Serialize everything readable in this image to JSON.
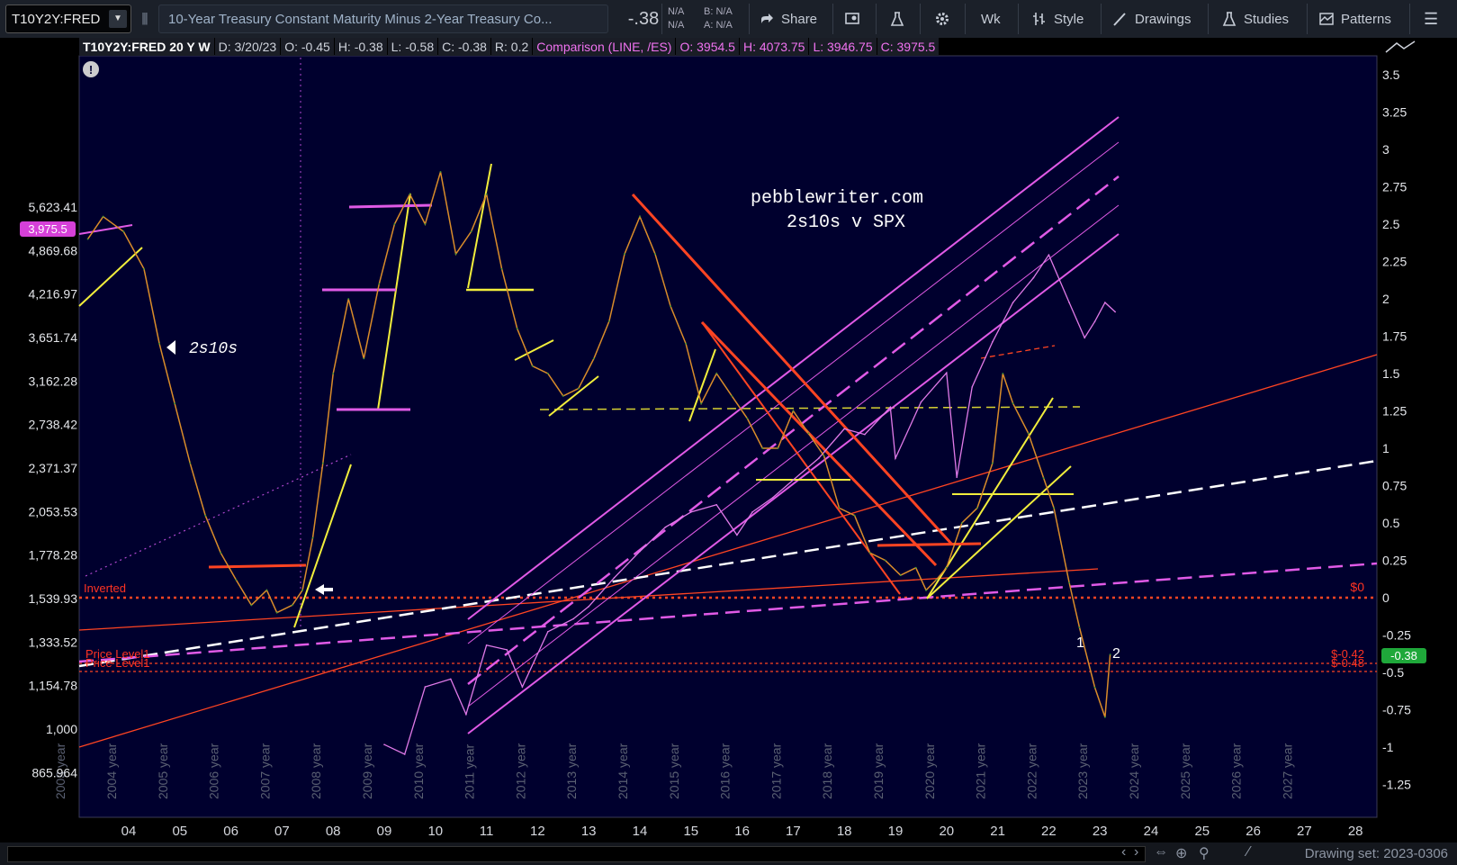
{
  "toolbar": {
    "symbol": "T10Y2Y:FRED",
    "description": "10-Year Treasury Constant Maturity Minus 2-Year Treasury Co...",
    "last": "-.38",
    "bid_na": "N/A",
    "ask_na": "N/A",
    "bid": "B: N/A",
    "ask": "A: N/A",
    "share": "Share",
    "wk": "Wk",
    "style": "Style",
    "drawings": "Drawings",
    "studies": "Studies",
    "patterns": "Patterns"
  },
  "legend": {
    "title": "T10Y2Y:FRED 20 Y W",
    "date": "D: 3/20/23",
    "open": "O: -0.45",
    "high": "H: -0.38",
    "low": "L: -0.58",
    "close": "C: -0.38",
    "range": "R: 0.2",
    "comparison": "Comparison (LINE, /ES)",
    "cmp_open": "O: 3954.5",
    "cmp_high": "H: 4073.75",
    "cmp_low": "L: 3946.75",
    "cmp_close": "C: 3975.5"
  },
  "annotations": {
    "watermark1": "pebblewriter.com",
    "watermark2": "2s10s v SPX",
    "series_label": "2s10s",
    "inverted": "Inverted",
    "zero_label": "$0",
    "price_level_1": "Price Level1",
    "price_level_2": "Price Level1",
    "pl_value_1": "$-0.42",
    "pl_value_2": "$-0.48",
    "last_badge": "-0.38",
    "spx_badge": "3,975.5",
    "wave_1": "1",
    "wave_2": "2"
  },
  "bottom": {
    "drawing_set": "Drawing set: 2023-0306"
  },
  "colors": {
    "background": "#00002e",
    "series": "#d98c2a",
    "comparison": "#e07ae8",
    "yellow": "#f2ee3c",
    "red": "#ff4422",
    "magenta": "#e05ae6",
    "last_badge": "#1fa83a"
  },
  "chart_data": {
    "type": "line",
    "x_ticks": [
      "04",
      "05",
      "06",
      "07",
      "08",
      "09",
      "10",
      "11",
      "12",
      "13",
      "14",
      "15",
      "16",
      "17",
      "18",
      "19",
      "20",
      "21",
      "22",
      "23",
      "24",
      "25",
      "26",
      "27",
      "28"
    ],
    "year_labels": [
      "2003 year",
      "2004 year",
      "2005 year",
      "2006 year",
      "2007 year",
      "2008 year",
      "2009 year",
      "2010 year",
      "2011 year",
      "2012 year",
      "2013 year",
      "2014 year",
      "2015 year",
      "2016 year",
      "2017 year",
      "2018 year",
      "2019 year",
      "2020 year",
      "2021 year",
      "2022 year",
      "2023 year",
      "2024 year",
      "2025 year",
      "2026 year",
      "2027 year"
    ],
    "right_ticks": [
      "3.5",
      "3.25",
      "3",
      "2.75",
      "2.5",
      "2.25",
      "2",
      "1.75",
      "1.5",
      "1.25",
      "1",
      "0.75",
      "0.5",
      "0.25",
      "0",
      "-0.25",
      "-0.5",
      "-0.75",
      "-1",
      "-1.25"
    ],
    "left_ticks": [
      "5,623.41",
      "4,869.68",
      "4,216.97",
      "3,651.74",
      "3,162.28",
      "2,738.42",
      "2,371.37",
      "2,053.53",
      "1,778.28",
      "1,539.93",
      "1,333.52",
      "1,154.78",
      "1,000",
      "865.964"
    ],
    "ylim_right": [
      -1.4,
      3.6
    ],
    "series": [
      {
        "name": "T10Y2Y:FRED",
        "points": [
          [
            2003.2,
            2.4
          ],
          [
            2003.5,
            2.55
          ],
          [
            2003.9,
            2.45
          ],
          [
            2004.3,
            2.2
          ],
          [
            2004.6,
            1.7
          ],
          [
            2004.9,
            1.3
          ],
          [
            2005.2,
            0.9
          ],
          [
            2005.5,
            0.55
          ],
          [
            2005.8,
            0.3
          ],
          [
            2006.1,
            0.12
          ],
          [
            2006.4,
            -0.05
          ],
          [
            2006.7,
            0.05
          ],
          [
            2006.9,
            -0.1
          ],
          [
            2007.2,
            -0.05
          ],
          [
            2007.4,
            0.05
          ],
          [
            2007.6,
            0.4
          ],
          [
            2007.8,
            0.9
          ],
          [
            2008.0,
            1.5
          ],
          [
            2008.3,
            2.0
          ],
          [
            2008.6,
            1.6
          ],
          [
            2008.9,
            2.1
          ],
          [
            2009.2,
            2.5
          ],
          [
            2009.5,
            2.7
          ],
          [
            2009.8,
            2.5
          ],
          [
            2010.1,
            2.85
          ],
          [
            2010.4,
            2.3
          ],
          [
            2010.7,
            2.45
          ],
          [
            2011.0,
            2.7
          ],
          [
            2011.3,
            2.2
          ],
          [
            2011.6,
            1.8
          ],
          [
            2011.9,
            1.55
          ],
          [
            2012.2,
            1.5
          ],
          [
            2012.5,
            1.35
          ],
          [
            2012.8,
            1.4
          ],
          [
            2013.1,
            1.6
          ],
          [
            2013.4,
            1.85
          ],
          [
            2013.7,
            2.3
          ],
          [
            2014.0,
            2.55
          ],
          [
            2014.3,
            2.3
          ],
          [
            2014.6,
            1.95
          ],
          [
            2014.9,
            1.7
          ],
          [
            2015.2,
            1.3
          ],
          [
            2015.5,
            1.5
          ],
          [
            2015.8,
            1.35
          ],
          [
            2016.1,
            1.2
          ],
          [
            2016.4,
            1.0
          ],
          [
            2016.7,
            1.0
          ],
          [
            2017.0,
            1.25
          ],
          [
            2017.3,
            1.1
          ],
          [
            2017.6,
            0.95
          ],
          [
            2017.9,
            0.6
          ],
          [
            2018.2,
            0.55
          ],
          [
            2018.5,
            0.3
          ],
          [
            2018.8,
            0.25
          ],
          [
            2019.1,
            0.15
          ],
          [
            2019.4,
            0.2
          ],
          [
            2019.6,
            0.05
          ],
          [
            2019.8,
            0.12
          ],
          [
            2020.0,
            0.2
          ],
          [
            2020.3,
            0.5
          ],
          [
            2020.6,
            0.6
          ],
          [
            2020.9,
            0.9
          ],
          [
            2021.1,
            1.5
          ],
          [
            2021.3,
            1.3
          ],
          [
            2021.6,
            1.1
          ],
          [
            2021.9,
            0.8
          ],
          [
            2022.1,
            0.6
          ],
          [
            2022.4,
            0.1
          ],
          [
            2022.6,
            -0.2
          ],
          [
            2022.9,
            -0.6
          ],
          [
            2023.1,
            -0.8
          ],
          [
            2023.2,
            -0.38
          ]
        ]
      },
      {
        "name": "/ES",
        "points": [
          [
            2009.0,
            950
          ],
          [
            2009.4,
            920
          ],
          [
            2009.8,
            1150
          ],
          [
            2010.3,
            1180
          ],
          [
            2010.6,
            1050
          ],
          [
            2011.0,
            1320
          ],
          [
            2011.4,
            1300
          ],
          [
            2011.7,
            1150
          ],
          [
            2012.2,
            1380
          ],
          [
            2012.7,
            1440
          ],
          [
            2013.0,
            1500
          ],
          [
            2013.5,
            1650
          ],
          [
            2014.0,
            1800
          ],
          [
            2014.5,
            1950
          ],
          [
            2015.0,
            2050
          ],
          [
            2015.5,
            2100
          ],
          [
            2015.9,
            1900
          ],
          [
            2016.2,
            2050
          ],
          [
            2016.6,
            2150
          ],
          [
            2017.0,
            2280
          ],
          [
            2017.5,
            2450
          ],
          [
            2018.0,
            2700
          ],
          [
            2018.4,
            2650
          ],
          [
            2018.9,
            2900
          ],
          [
            2019.0,
            2450
          ],
          [
            2019.5,
            2950
          ],
          [
            2020.0,
            3250
          ],
          [
            2020.2,
            2300
          ],
          [
            2020.5,
            3100
          ],
          [
            2020.9,
            3600
          ],
          [
            2021.3,
            4100
          ],
          [
            2021.7,
            4450
          ],
          [
            2022.0,
            4800
          ],
          [
            2022.4,
            4100
          ],
          [
            2022.7,
            3650
          ],
          [
            2022.9,
            3850
          ],
          [
            2023.1,
            4100
          ],
          [
            2023.3,
            3975.5
          ]
        ]
      }
    ]
  }
}
